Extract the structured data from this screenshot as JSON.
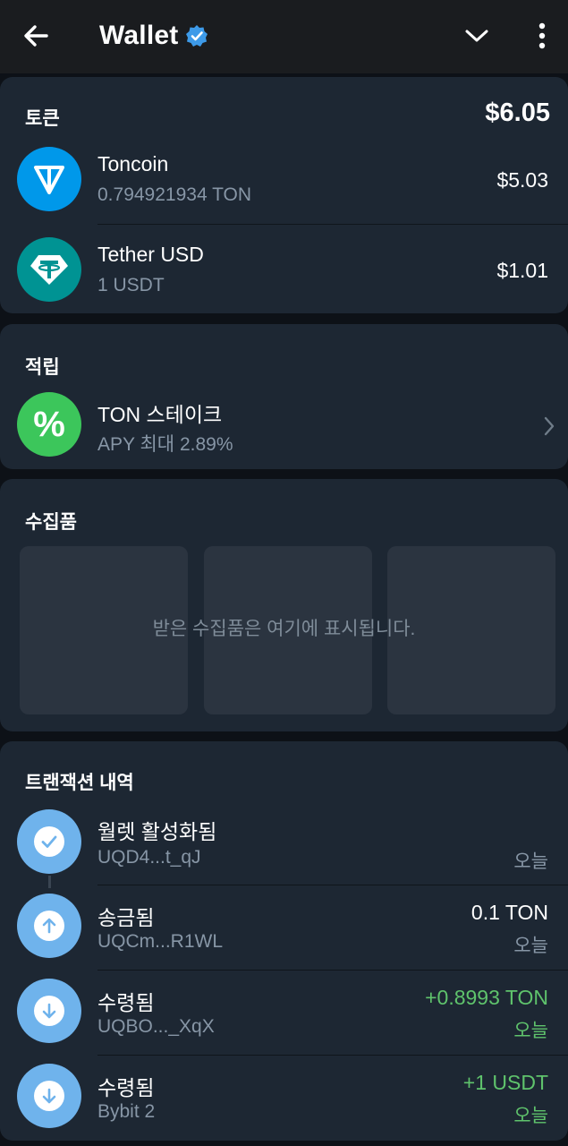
{
  "header": {
    "title": "Wallet",
    "colors": {
      "background": "#1a1c1f",
      "verified": "#3d9ae8"
    }
  },
  "tokens": {
    "title": "토큰",
    "total": "$6.05",
    "items": [
      {
        "name": "Toncoin",
        "balance": "0.794921934 TON",
        "value": "$5.03",
        "icon": "toncoin-icon",
        "color": "#0098ea"
      },
      {
        "name": "Tether USD",
        "balance": "1 USDT",
        "value": "$1.01",
        "icon": "tether-icon",
        "color": "#009393"
      }
    ]
  },
  "staking": {
    "title": "적립",
    "item": {
      "name": "TON 스테이크",
      "apy": "APY 최대 2.89%",
      "icon": "percent-icon",
      "color": "#3cc65b"
    }
  },
  "collectibles": {
    "title": "수집품",
    "empty_text": "받은 수집품은 여기에 표시됩니다."
  },
  "transactions": {
    "title": "트랜잭션 내역",
    "items": [
      {
        "title": "월렛 활성화됨",
        "address": "UQD4...t_qJ",
        "amount": "",
        "date": "오늘",
        "icon": "check-icon"
      },
      {
        "title": "송금됨",
        "address": "UQCm...R1WL",
        "amount": "0.1 TON",
        "date": "오늘",
        "icon": "arrow-up-icon"
      },
      {
        "title": "수령됨",
        "address": "UQBO..._XqX",
        "amount": "+0.8993 TON",
        "date": "오늘",
        "icon": "arrow-down-icon"
      },
      {
        "title": "수령됨",
        "address": "Bybit 2",
        "amount": "+1 USDT",
        "date": "오늘",
        "icon": "arrow-down-icon"
      }
    ]
  }
}
